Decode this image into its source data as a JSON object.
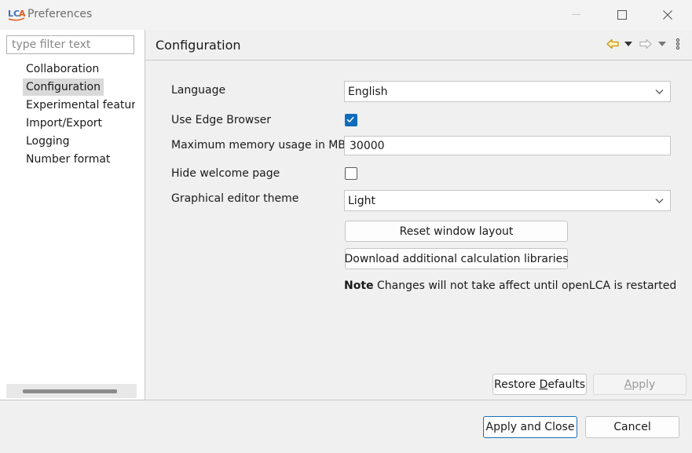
{
  "window": {
    "logo_text": "LCA",
    "title": "Preferences"
  },
  "sidebar": {
    "filter_placeholder": "type filter text",
    "items": [
      {
        "label": "Collaboration",
        "selected": false
      },
      {
        "label": "Configuration",
        "selected": true
      },
      {
        "label": "Experimental features",
        "selected": false
      },
      {
        "label": "Import/Export",
        "selected": false
      },
      {
        "label": "Logging",
        "selected": false
      },
      {
        "label": "Number format",
        "selected": false
      }
    ]
  },
  "page": {
    "title": "Configuration",
    "fields": {
      "language": {
        "label": "Language",
        "value": "English"
      },
      "edge_browser": {
        "label": "Use Edge Browser",
        "checked": true
      },
      "max_memory": {
        "label": "Maximum memory usage in MB",
        "value": "30000"
      },
      "hide_welcome": {
        "label": "Hide welcome page",
        "checked": false
      },
      "editor_theme": {
        "label": "Graphical editor theme",
        "value": "Light"
      }
    },
    "reset_layout_label": "Reset window layout",
    "download_libs_label": "Download additional calculation libraries",
    "note_bold": "Note",
    "note_text": " Changes will not take affect until openLCA is restarted",
    "restore_defaults_label_pre": "Restore ",
    "restore_defaults_label_mnemonic": "D",
    "restore_defaults_label_post": "efaults",
    "apply_label_mnemonic": "A",
    "apply_label_post": "pply"
  },
  "footer": {
    "apply_close_label": "Apply and Close",
    "cancel_label": "Cancel"
  },
  "colors": {
    "accent": "#0f6cbd",
    "back_arrow": "#e0a000"
  }
}
